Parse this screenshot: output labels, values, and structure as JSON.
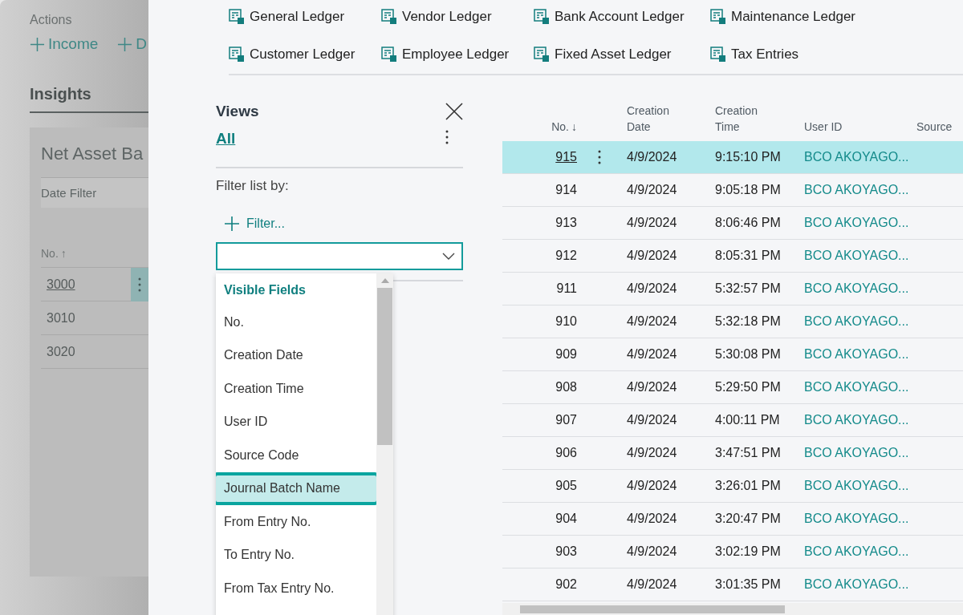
{
  "background_page": {
    "actions_label": "Actions",
    "actions": [
      {
        "label": "Income"
      },
      {
        "label": "D"
      }
    ],
    "insights_tab": "Insights",
    "card": {
      "title": "Net Asset Ba",
      "filter_label": "Date Filter",
      "column": {
        "label": "No.",
        "sort_arrow": "↑"
      },
      "rows": [
        {
          "no": "3000",
          "selected": true
        },
        {
          "no": "3010",
          "selected": false
        },
        {
          "no": "3020",
          "selected": false
        }
      ]
    }
  },
  "actions": [
    {
      "label": "General Ledger"
    },
    {
      "label": "Vendor Ledger"
    },
    {
      "label": "Bank Account Ledger"
    },
    {
      "label": "Maintenance Ledger"
    },
    {
      "label": "Customer Ledger"
    },
    {
      "label": "Employee Ledger"
    },
    {
      "label": "Fixed Asset Ledger"
    },
    {
      "label": "Tax Entries"
    }
  ],
  "views_pane": {
    "title": "Views",
    "views": [
      {
        "label": "All",
        "selected": true
      }
    ],
    "filter_label": "Filter list by:",
    "add_filter": "Filter...",
    "dropdown": {
      "group_label": "Visible Fields",
      "items": [
        {
          "label": "No.",
          "selected": false
        },
        {
          "label": "Creation Date",
          "selected": false
        },
        {
          "label": "Creation Time",
          "selected": false
        },
        {
          "label": "User ID",
          "selected": false
        },
        {
          "label": "Source Code",
          "selected": false
        },
        {
          "label": "Journal Batch Name",
          "selected": true
        },
        {
          "label": "From Entry No.",
          "selected": false
        },
        {
          "label": "To Entry No.",
          "selected": false
        },
        {
          "label": "From Tax Entry No.",
          "selected": false
        }
      ]
    }
  },
  "table": {
    "columns": [
      {
        "label": "No.",
        "sort_arrow": "↓"
      },
      {
        "label": "Creation Date"
      },
      {
        "label": "Creation Time"
      },
      {
        "label": "User ID"
      },
      {
        "label": "Source"
      }
    ],
    "rows": [
      {
        "no": "915",
        "date": "4/9/2024",
        "time": "9:15:10 PM",
        "user": "BCO AKOYAGO...",
        "selected": true
      },
      {
        "no": "914",
        "date": "4/9/2024",
        "time": "9:05:18 PM",
        "user": "BCO AKOYAGO...",
        "selected": false
      },
      {
        "no": "913",
        "date": "4/9/2024",
        "time": "8:06:46 PM",
        "user": "BCO AKOYAGO...",
        "selected": false
      },
      {
        "no": "912",
        "date": "4/9/2024",
        "time": "8:05:31 PM",
        "user": "BCO AKOYAGO...",
        "selected": false
      },
      {
        "no": "911",
        "date": "4/9/2024",
        "time": "5:32:57 PM",
        "user": "BCO AKOYAGO...",
        "selected": false
      },
      {
        "no": "910",
        "date": "4/9/2024",
        "time": "5:32:18 PM",
        "user": "BCO AKOYAGO...",
        "selected": false
      },
      {
        "no": "909",
        "date": "4/9/2024",
        "time": "5:30:08 PM",
        "user": "BCO AKOYAGO...",
        "selected": false
      },
      {
        "no": "908",
        "date": "4/9/2024",
        "time": "5:29:50 PM",
        "user": "BCO AKOYAGO...",
        "selected": false
      },
      {
        "no": "907",
        "date": "4/9/2024",
        "time": "4:00:11 PM",
        "user": "BCO AKOYAGO...",
        "selected": false
      },
      {
        "no": "906",
        "date": "4/9/2024",
        "time": "3:47:51 PM",
        "user": "BCO AKOYAGO...",
        "selected": false
      },
      {
        "no": "905",
        "date": "4/9/2024",
        "time": "3:26:01 PM",
        "user": "BCO AKOYAGO...",
        "selected": false
      },
      {
        "no": "904",
        "date": "4/9/2024",
        "time": "3:20:47 PM",
        "user": "BCO AKOYAGO...",
        "selected": false
      },
      {
        "no": "903",
        "date": "4/9/2024",
        "time": "3:02:19 PM",
        "user": "BCO AKOYAGO...",
        "selected": false
      },
      {
        "no": "902",
        "date": "4/9/2024",
        "time": "3:01:35 PM",
        "user": "BCO AKOYAGO...",
        "selected": false
      }
    ]
  }
}
